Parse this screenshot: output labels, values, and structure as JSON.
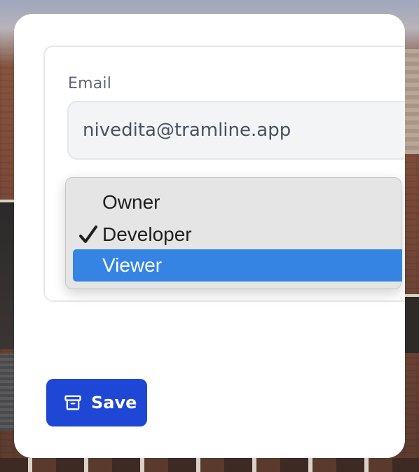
{
  "form": {
    "email_label": "Email",
    "email_value": "nivedita@tramline.app"
  },
  "role_dropdown": {
    "options": [
      {
        "label": "Owner",
        "checked": false,
        "highlighted": false
      },
      {
        "label": "Developer",
        "checked": true,
        "highlighted": false
      },
      {
        "label": "Viewer",
        "checked": false,
        "highlighted": true
      }
    ],
    "highlight_color": "#3584e4"
  },
  "actions": {
    "save_label": "Save",
    "save_icon": "archive-box-icon",
    "save_color": "#1f47d6"
  }
}
